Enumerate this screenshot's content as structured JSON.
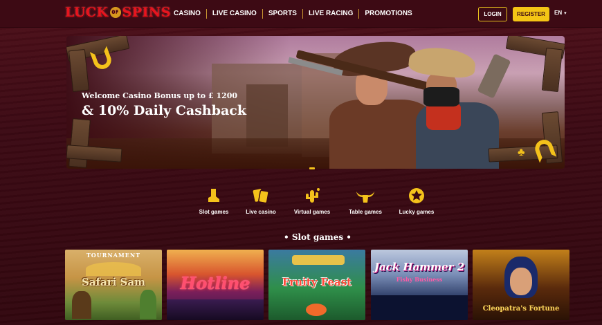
{
  "brand": {
    "logo_text_left": "LUCK",
    "logo_text_of": "OF",
    "logo_text_right": "SPINS"
  },
  "nav": {
    "items": [
      {
        "label": "CASINO"
      },
      {
        "label": "LIVE CASINO"
      },
      {
        "label": "SPORTS"
      },
      {
        "label": "LIVE RACING"
      },
      {
        "label": "PROMOTIONS"
      }
    ]
  },
  "auth": {
    "login_label": "LOGIN",
    "register_label": "REGISTER"
  },
  "language": {
    "current": "EN"
  },
  "hero": {
    "subtitle": "Welcome Casino Bonus up to £ 1200",
    "title": "& 10% Daily Cashback"
  },
  "categories": [
    {
      "label": "Slot games",
      "icon": "cowboy-boot-icon"
    },
    {
      "label": "Live casino",
      "icon": "playing-cards-icon"
    },
    {
      "label": "Virtual games",
      "icon": "cactus-icon"
    },
    {
      "label": "Table games",
      "icon": "bull-horns-icon"
    },
    {
      "label": "Lucky games",
      "icon": "sheriff-star-icon"
    }
  ],
  "section": {
    "title": "• Slot games •"
  },
  "games": [
    {
      "name": "Safari Sam",
      "badge": "TOURNAMENT"
    },
    {
      "name": "Hotline"
    },
    {
      "name": "Fruity Feast"
    },
    {
      "name": "Jack Hammer 2",
      "subtitle": "Fishy Business"
    },
    {
      "name": "Cleopatra's Fortune"
    }
  ],
  "colors": {
    "background": "#3a0912",
    "header": "#3d0a14",
    "accent_gold": "#f4c515",
    "logo_red": "#e8141e"
  }
}
